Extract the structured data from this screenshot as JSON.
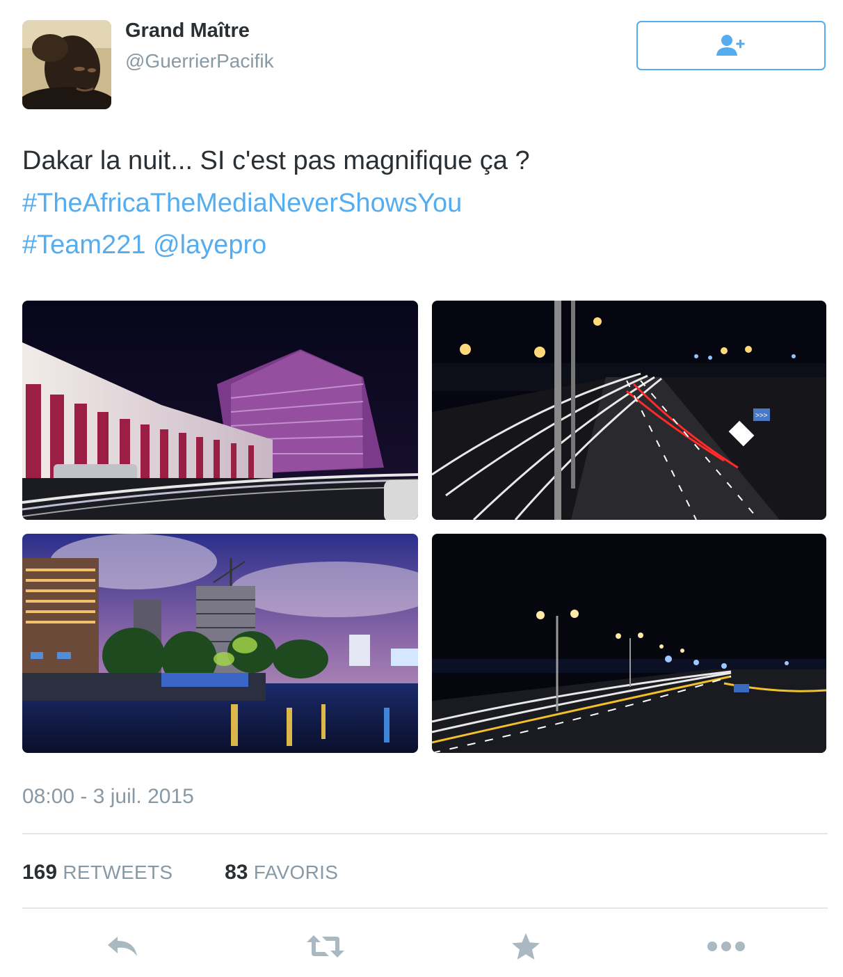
{
  "user": {
    "display_name": "Grand Maître",
    "handle": "@GuerrierPacifik"
  },
  "follow_button": {
    "icon": "add-user-icon"
  },
  "tweet": {
    "text": "Dakar la nuit... SI c'est pas magnifique ça ?",
    "hashtag_1": "#TheAfricaTheMediaNeverShowsYou",
    "hashtag_2": "#Team221",
    "mention": "@layepro"
  },
  "timestamp": "08:00 - 3 juil. 2015",
  "stats": {
    "retweets_count": "169",
    "retweets_label": "RETWEETS",
    "favorites_count": "83",
    "favorites_label": "FAVORIS"
  },
  "actions": [
    "reply-icon",
    "retweet-icon",
    "favorite-star-icon",
    "more-icon"
  ],
  "colors": {
    "accent": "#55acee",
    "text": "#292f33",
    "muted": "#8899a6",
    "divider": "#e1e8ed",
    "action_icon": "#aab8c2"
  }
}
